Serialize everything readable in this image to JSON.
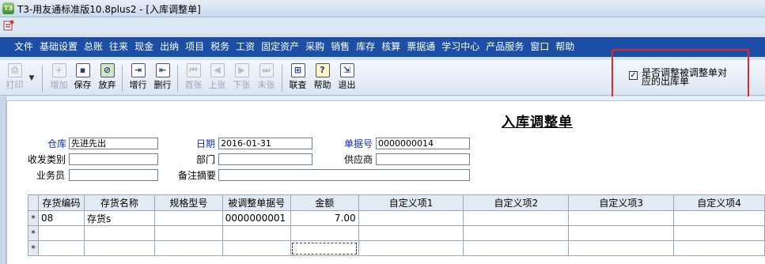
{
  "window": {
    "title": "T3-用友通标准版10.8plus2 - [入库调整单]",
    "app_icon_text": "T3"
  },
  "menu": [
    "文件",
    "基础设置",
    "总账",
    "往来",
    "现金",
    "出纳",
    "项目",
    "税务",
    "工资",
    "固定资产",
    "采购",
    "销售",
    "库存",
    "核算",
    "票据通",
    "学习中心",
    "产品服务",
    "窗口",
    "帮助"
  ],
  "toolbar": {
    "print": "打印",
    "add": "增加",
    "save": "保存",
    "abandon": "放弃",
    "add_row": "增行",
    "delete_row": "删行",
    "first": "首张",
    "prev": "上张",
    "next": "下张",
    "last": "末张",
    "link_query": "联查",
    "help": "帮助",
    "exit": "退出"
  },
  "option": {
    "label": "是否调整被调整单对应的出库单",
    "checked": true,
    "check_mark": "✓"
  },
  "doc": {
    "title": "入库调整单",
    "fields": {
      "warehouse_label": "仓库",
      "warehouse_value": "先进先出",
      "date_label": "日期",
      "date_value": "2016-01-31",
      "doc_no_label": "单据号",
      "doc_no_value": "0000000014",
      "rs_type_label": "收发类别",
      "rs_type_value": "",
      "dept_label": "部门",
      "dept_value": "",
      "supplier_label": "供应商",
      "supplier_value": "",
      "clerk_label": "业务员",
      "clerk_value": "",
      "remark_label": "备注摘要",
      "remark_value": ""
    }
  },
  "grid": {
    "headers": [
      "存货编码",
      "存货名称",
      "规格型号",
      "被调整单据号",
      "金额",
      "自定义项1",
      "自定义项2",
      "自定义项3",
      "自定义项4"
    ],
    "rows": [
      {
        "marker": "*",
        "code": "08",
        "name": "存货s",
        "spec": "",
        "adj_doc_no": "0000000001",
        "amount": "7.00"
      },
      {
        "marker": "*",
        "code": "",
        "name": "",
        "spec": "",
        "adj_doc_no": "",
        "amount": ""
      },
      {
        "marker": "*",
        "code": "",
        "name": "",
        "spec": "",
        "adj_doc_no": "",
        "amount": ""
      }
    ]
  },
  "colors": {
    "menubar_bg": "#1b4fa6",
    "label_blue": "#1330c8",
    "highlight_red": "#e5252a"
  }
}
